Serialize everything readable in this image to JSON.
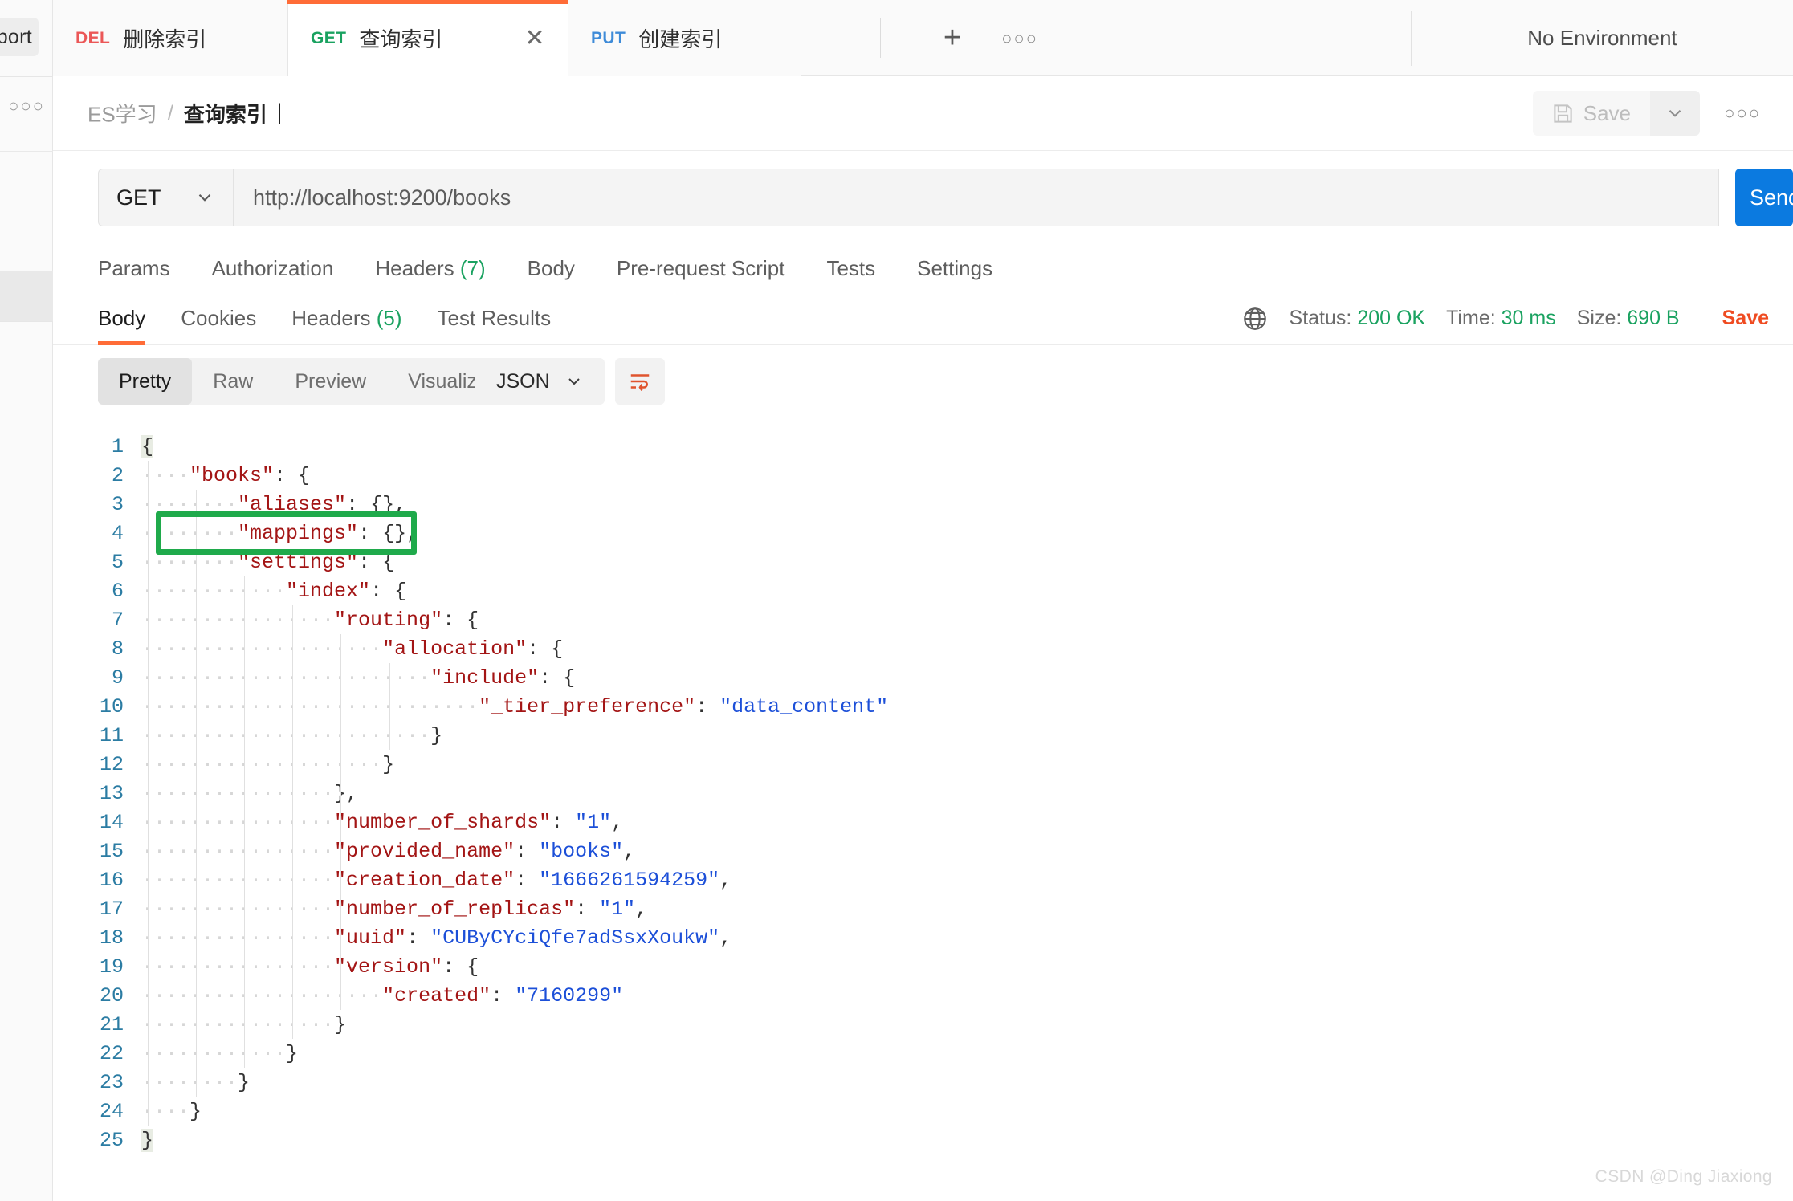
{
  "left_rail": {
    "import_label": "Import",
    "more_icon": "more-horizontal-icon"
  },
  "tabbar": {
    "tabs": [
      {
        "method": "DEL",
        "name": "删除索引",
        "active": false
      },
      {
        "method": "GET",
        "name": "查询索引",
        "active": true
      },
      {
        "method": "PUT",
        "name": "创建索引",
        "active": false
      }
    ],
    "new_tab_icon": "plus-icon",
    "more_icon": "more-horizontal-icon",
    "environment": "No Environment"
  },
  "breadcrumb": {
    "root": "ES学习",
    "separator": "/",
    "leaf": "查询索引"
  },
  "actions": {
    "save_label": "Save",
    "save_icon": "floppy-disk-icon",
    "caret_icon": "chevron-down-icon",
    "more_icon": "more-horizontal-icon"
  },
  "request": {
    "method": "GET",
    "url": "http://localhost:9200/books",
    "send_label": "Send",
    "tabs": [
      {
        "label": "Params",
        "count": ""
      },
      {
        "label": "Authorization",
        "count": ""
      },
      {
        "label": "Headers",
        "count": "(7)"
      },
      {
        "label": "Body",
        "count": ""
      },
      {
        "label": "Pre-request Script",
        "count": ""
      },
      {
        "label": "Tests",
        "count": ""
      },
      {
        "label": "Settings",
        "count": ""
      }
    ]
  },
  "response": {
    "tabs": [
      {
        "label": "Body",
        "count": "",
        "active": true
      },
      {
        "label": "Cookies",
        "count": "",
        "active": false
      },
      {
        "label": "Headers",
        "count": "(5)",
        "active": false
      },
      {
        "label": "Test Results",
        "count": "",
        "active": false
      }
    ],
    "globe_icon": "globe-icon",
    "status_label": "Status:",
    "status_value": "200 OK",
    "time_label": "Time:",
    "time_value": "30 ms",
    "size_label": "Size:",
    "size_value": "690 B",
    "save_response_label": "Save",
    "view_modes": [
      "Pretty",
      "Raw",
      "Preview",
      "Visualize"
    ],
    "active_view": "Pretty",
    "format": "JSON",
    "format_caret_icon": "chevron-down-icon",
    "wrap_icon": "text-wrap-icon",
    "body_lines": [
      {
        "n": 1,
        "indent": 0,
        "segs": [
          {
            "t": "{",
            "c": "p"
          }
        ]
      },
      {
        "n": 2,
        "indent": 1,
        "segs": [
          {
            "t": "\"books\"",
            "c": "k"
          },
          {
            "t": ": {",
            "c": "p"
          }
        ]
      },
      {
        "n": 3,
        "indent": 2,
        "segs": [
          {
            "t": "\"aliases\"",
            "c": "k"
          },
          {
            "t": ": {},",
            "c": "p"
          }
        ]
      },
      {
        "n": 4,
        "indent": 2,
        "segs": [
          {
            "t": "\"mappings\"",
            "c": "k"
          },
          {
            "t": ": {},",
            "c": "p"
          }
        ]
      },
      {
        "n": 5,
        "indent": 2,
        "segs": [
          {
            "t": "\"settings\"",
            "c": "k"
          },
          {
            "t": ": {",
            "c": "p"
          }
        ]
      },
      {
        "n": 6,
        "indent": 3,
        "segs": [
          {
            "t": "\"index\"",
            "c": "k"
          },
          {
            "t": ": {",
            "c": "p"
          }
        ]
      },
      {
        "n": 7,
        "indent": 4,
        "segs": [
          {
            "t": "\"routing\"",
            "c": "k"
          },
          {
            "t": ": {",
            "c": "p"
          }
        ]
      },
      {
        "n": 8,
        "indent": 5,
        "segs": [
          {
            "t": "\"allocation\"",
            "c": "k"
          },
          {
            "t": ": {",
            "c": "p"
          }
        ]
      },
      {
        "n": 9,
        "indent": 6,
        "segs": [
          {
            "t": "\"include\"",
            "c": "k"
          },
          {
            "t": ": {",
            "c": "p"
          }
        ]
      },
      {
        "n": 10,
        "indent": 7,
        "segs": [
          {
            "t": "\"_tier_preference\"",
            "c": "k"
          },
          {
            "t": ": ",
            "c": "p"
          },
          {
            "t": "\"data_content\"",
            "c": "v-str"
          }
        ]
      },
      {
        "n": 11,
        "indent": 6,
        "segs": [
          {
            "t": "}",
            "c": "p"
          }
        ]
      },
      {
        "n": 12,
        "indent": 5,
        "segs": [
          {
            "t": "}",
            "c": "p"
          }
        ]
      },
      {
        "n": 13,
        "indent": 4,
        "segs": [
          {
            "t": "},",
            "c": "p"
          }
        ]
      },
      {
        "n": 14,
        "indent": 4,
        "segs": [
          {
            "t": "\"number_of_shards\"",
            "c": "k"
          },
          {
            "t": ": ",
            "c": "p"
          },
          {
            "t": "\"1\"",
            "c": "v-str"
          },
          {
            "t": ",",
            "c": "p"
          }
        ]
      },
      {
        "n": 15,
        "indent": 4,
        "segs": [
          {
            "t": "\"provided_name\"",
            "c": "k"
          },
          {
            "t": ": ",
            "c": "p"
          },
          {
            "t": "\"books\"",
            "c": "v-str"
          },
          {
            "t": ",",
            "c": "p"
          }
        ]
      },
      {
        "n": 16,
        "indent": 4,
        "segs": [
          {
            "t": "\"creation_date\"",
            "c": "k"
          },
          {
            "t": ": ",
            "c": "p"
          },
          {
            "t": "\"1666261594259\"",
            "c": "v-str"
          },
          {
            "t": ",",
            "c": "p"
          }
        ]
      },
      {
        "n": 17,
        "indent": 4,
        "segs": [
          {
            "t": "\"number_of_replicas\"",
            "c": "k"
          },
          {
            "t": ": ",
            "c": "p"
          },
          {
            "t": "\"1\"",
            "c": "v-str"
          },
          {
            "t": ",",
            "c": "p"
          }
        ]
      },
      {
        "n": 18,
        "indent": 4,
        "segs": [
          {
            "t": "\"uuid\"",
            "c": "k"
          },
          {
            "t": ": ",
            "c": "p"
          },
          {
            "t": "\"CUByCYciQfe7adSsxXoukw\"",
            "c": "v-str"
          },
          {
            "t": ",",
            "c": "p"
          }
        ]
      },
      {
        "n": 19,
        "indent": 4,
        "segs": [
          {
            "t": "\"version\"",
            "c": "k"
          },
          {
            "t": ": {",
            "c": "p"
          }
        ]
      },
      {
        "n": 20,
        "indent": 5,
        "segs": [
          {
            "t": "\"created\"",
            "c": "k"
          },
          {
            "t": ": ",
            "c": "p"
          },
          {
            "t": "\"7160299\"",
            "c": "v-str"
          }
        ]
      },
      {
        "n": 21,
        "indent": 4,
        "segs": [
          {
            "t": "}",
            "c": "p"
          }
        ]
      },
      {
        "n": 22,
        "indent": 3,
        "segs": [
          {
            "t": "}",
            "c": "p"
          }
        ]
      },
      {
        "n": 23,
        "indent": 2,
        "segs": [
          {
            "t": "}",
            "c": "p"
          }
        ]
      },
      {
        "n": 24,
        "indent": 1,
        "segs": [
          {
            "t": "}",
            "c": "p"
          }
        ]
      },
      {
        "n": 25,
        "indent": 0,
        "segs": [
          {
            "t": "}",
            "c": "p"
          }
        ]
      }
    ]
  },
  "annotation": {
    "target_line": 4,
    "color": "#1faa4b"
  },
  "watermark": "CSDN @Ding Jiaxiong"
}
